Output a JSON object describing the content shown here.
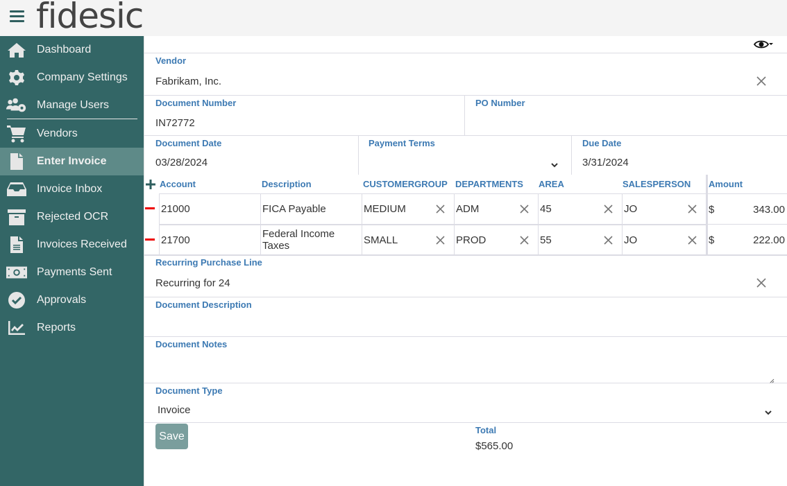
{
  "app": {
    "logo": "fidesic"
  },
  "sidebar": {
    "items": [
      {
        "label": "Dashboard",
        "icon": "home-icon"
      },
      {
        "label": "Company Settings",
        "icon": "gear-icon"
      },
      {
        "label": "Manage Users",
        "icon": "users-gear-icon"
      },
      {
        "label": "Vendors",
        "icon": "cart-icon"
      },
      {
        "label": "Enter Invoice",
        "icon": "file-icon",
        "active": true
      },
      {
        "label": "Invoice Inbox",
        "icon": "inbox-icon"
      },
      {
        "label": "Rejected OCR",
        "icon": "archive-icon"
      },
      {
        "label": "Invoices Received",
        "icon": "file-text-icon"
      },
      {
        "label": "Payments Sent",
        "icon": "money-bill-icon"
      },
      {
        "label": "Approvals",
        "icon": "check-circle-icon"
      },
      {
        "label": "Reports",
        "icon": "chart-line-icon"
      }
    ]
  },
  "form": {
    "vendor": {
      "label": "Vendor",
      "value": "Fabrikam, Inc."
    },
    "document_number": {
      "label": "Document Number",
      "value": "IN72772"
    },
    "po_number": {
      "label": "PO Number",
      "value": ""
    },
    "document_date": {
      "label": "Document Date",
      "value": "03/28/2024"
    },
    "payment_terms": {
      "label": "Payment Terms",
      "value": ""
    },
    "due_date": {
      "label": "Due Date",
      "value": "3/31/2024"
    },
    "lines": {
      "headers": [
        "Account",
        "Description",
        "CUSTOMERGROUP",
        "DEPARTMENTS",
        "AREA",
        "SALESPERSON",
        "Amount"
      ],
      "rows": [
        {
          "account": "21000",
          "description": "FICA Payable",
          "customergroup": "MEDIUM",
          "departments": "ADM",
          "area": "45",
          "salesperson": "JO",
          "currency": "$",
          "amount": "343.00"
        },
        {
          "account": "21700",
          "description": "Federal Income Taxes",
          "customergroup": "SMALL",
          "departments": "PROD",
          "area": "55",
          "salesperson": "JO",
          "currency": "$",
          "amount": "222.00"
        }
      ]
    },
    "recurring": {
      "label": "Recurring Purchase Line",
      "value": "Recurring for 24"
    },
    "document_description": {
      "label": "Document Description",
      "value": ""
    },
    "document_notes": {
      "label": "Document Notes",
      "value": ""
    },
    "document_type": {
      "label": "Document Type",
      "value": "Invoice"
    },
    "save_label": "Save",
    "total": {
      "label": "Total",
      "value": "$565.00"
    }
  },
  "colors": {
    "sidebar": "#336666",
    "sidebar_active": "#5e8a88",
    "label": "#3d7ab3",
    "remove": "#ee0000",
    "save": "#7a9e9d"
  }
}
